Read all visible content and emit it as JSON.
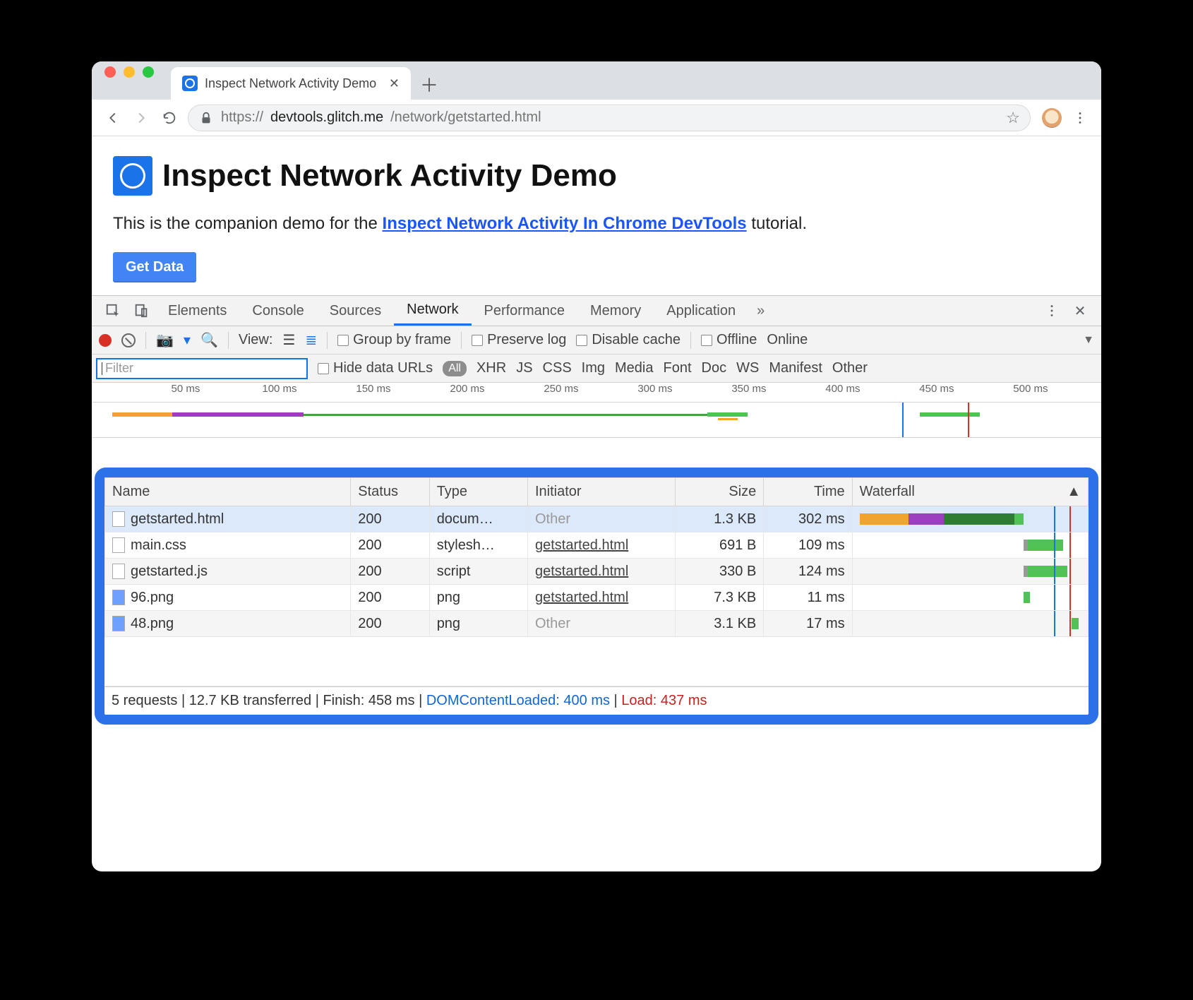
{
  "browser": {
    "tab_title": "Inspect Network Activity Demo",
    "url_secure": "https://",
    "url_host": "devtools.glitch.me",
    "url_path": "/network/getstarted.html"
  },
  "page": {
    "heading": "Inspect Network Activity Demo",
    "intro_prefix": "This is the companion demo for the ",
    "intro_link": "Inspect Network Activity In Chrome DevTools",
    "intro_suffix": " tutorial.",
    "button": "Get Data"
  },
  "devtools": {
    "tabs": [
      "Elements",
      "Console",
      "Sources",
      "Network",
      "Performance",
      "Memory",
      "Application"
    ],
    "active_tab": "Network",
    "more": "»",
    "toolbar": {
      "view_label": "View:",
      "group": "Group by frame",
      "preserve": "Preserve log",
      "disable": "Disable cache",
      "offline": "Offline",
      "online": "Online"
    },
    "filter": {
      "placeholder": "Filter",
      "hide": "Hide data URLs",
      "all": "All",
      "types": [
        "XHR",
        "JS",
        "CSS",
        "Img",
        "Media",
        "Font",
        "Doc",
        "WS",
        "Manifest",
        "Other"
      ]
    },
    "ruler_ticks": [
      "50 ms",
      "100 ms",
      "150 ms",
      "200 ms",
      "250 ms",
      "300 ms",
      "350 ms",
      "400 ms",
      "450 ms",
      "500 ms"
    ],
    "columns": [
      "Name",
      "Status",
      "Type",
      "Initiator",
      "Size",
      "Time",
      "Waterfall"
    ],
    "rows": [
      {
        "name": "getstarted.html",
        "status": "200",
        "type": "docum…",
        "initiator": "Other",
        "initiator_link": false,
        "size": "1.3 KB",
        "time": "302 ms",
        "sel": true,
        "wf": [
          {
            "l": 0,
            "w": 22,
            "c": "#f0a32f"
          },
          {
            "l": 22,
            "w": 16,
            "c": "#9b3fbf"
          },
          {
            "l": 38,
            "w": 32,
            "c": "#2e7d32"
          },
          {
            "l": 70,
            "w": 4,
            "c": "#51c356"
          }
        ]
      },
      {
        "name": "main.css",
        "status": "200",
        "type": "stylesh…",
        "initiator": "getstarted.html",
        "initiator_link": true,
        "size": "691 B",
        "time": "109 ms",
        "wf": [
          {
            "l": 74,
            "w": 2,
            "c": "#999"
          },
          {
            "l": 76,
            "w": 16,
            "c": "#51c356"
          }
        ]
      },
      {
        "name": "getstarted.js",
        "status": "200",
        "type": "script",
        "initiator": "getstarted.html",
        "initiator_link": true,
        "size": "330 B",
        "time": "124 ms",
        "alt": true,
        "wf": [
          {
            "l": 74,
            "w": 2,
            "c": "#999"
          },
          {
            "l": 76,
            "w": 18,
            "c": "#51c356"
          }
        ]
      },
      {
        "name": "96.png",
        "status": "200",
        "type": "png",
        "initiator": "getstarted.html",
        "initiator_link": true,
        "size": "7.3 KB",
        "time": "11 ms",
        "img": true,
        "wf": [
          {
            "l": 74,
            "w": 3,
            "c": "#51c356"
          }
        ]
      },
      {
        "name": "48.png",
        "status": "200",
        "type": "png",
        "initiator": "Other",
        "initiator_link": false,
        "size": "3.1 KB",
        "time": "17 ms",
        "alt": true,
        "img": true,
        "wf": [
          {
            "l": 96,
            "w": 3,
            "c": "#51c356"
          }
        ]
      }
    ],
    "summary": {
      "requests": "5 requests",
      "transferred": "12.7 KB transferred",
      "finish": "Finish: 458 ms",
      "dcl": "DOMContentLoaded: 400 ms",
      "load": "Load: 437 ms"
    }
  }
}
